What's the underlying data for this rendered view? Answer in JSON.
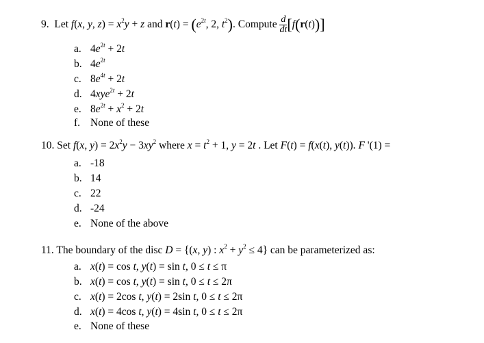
{
  "questions": [
    {
      "number": "9.",
      "prompt": "Let f(x, y, z) = x²y + z and r(t) = (e^{2t}, 2, t²). Compute d/dt[f(r(t))]",
      "options": [
        {
          "label": "a.",
          "text": "4e^{2t} + 2t"
        },
        {
          "label": "b.",
          "text": "4e^{2t}"
        },
        {
          "label": "c.",
          "text": "8e^{4t} + 2t"
        },
        {
          "label": "d.",
          "text": "4xye^{2t} + 2t"
        },
        {
          "label": "e.",
          "text": "8e^{2t} + x² + 2t"
        },
        {
          "label": "f.",
          "text": "None of these"
        }
      ]
    },
    {
      "number": "10.",
      "prompt": "Set f(x, y) = 2x²y − 3xy² where x = t² + 1, y = 2t . Let F(t) = f(x(t), y(t)). F '(1) =",
      "options": [
        {
          "label": "a.",
          "text": "-18"
        },
        {
          "label": "b.",
          "text": "14"
        },
        {
          "label": "c.",
          "text": "22"
        },
        {
          "label": "d.",
          "text": "-24"
        },
        {
          "label": "e.",
          "text": "None of the above"
        }
      ]
    },
    {
      "number": "11.",
      "prompt": "The boundary of the disc D = {(x, y) : x² + y² ≤ 4} can be parameterized as:",
      "options": [
        {
          "label": "a.",
          "text": "x(t) = cos t, y(t) = sin t, 0 ≤ t ≤ π"
        },
        {
          "label": "b.",
          "text": "x(t) = cos t, y(t) = sin t, 0 ≤ t ≤ 2π"
        },
        {
          "label": "c.",
          "text": "x(t) = 2cos t, y(t) = 2sin t, 0 ≤ t ≤ 2π"
        },
        {
          "label": "d.",
          "text": "x(t) = 4cos t, y(t) = 4sin t, 0 ≤ t ≤ 2π"
        },
        {
          "label": "e.",
          "text": "None of these"
        }
      ]
    }
  ],
  "text": {
    "none_these": "None of these",
    "none_above": "None of the above",
    "q10_a": "-18",
    "q10_b": "14",
    "q10_c": "22",
    "q10_d": "-24"
  }
}
